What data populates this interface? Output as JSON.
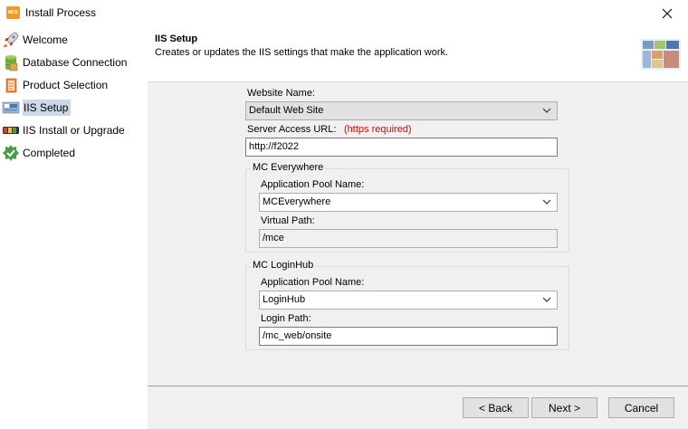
{
  "window": {
    "title": "Install Process",
    "app_icon_text": "MCE",
    "close_icon": "close-icon"
  },
  "sidebar": {
    "items": [
      {
        "label": "Welcome",
        "icon": "rocket-icon"
      },
      {
        "label": "Database Connection",
        "icon": "database-icon"
      },
      {
        "label": "Product Selection",
        "icon": "box-icon"
      },
      {
        "label": "IIS Setup",
        "icon": "iis-icon",
        "active": true
      },
      {
        "label": "IIS Install or Upgrade",
        "icon": "progress-bar-icon"
      },
      {
        "label": "Completed",
        "icon": "check-badge-icon"
      }
    ]
  },
  "header": {
    "title": "IIS Setup",
    "subtitle": "Creates or updates the IIS settings that make the application work.",
    "graphic_icon": "iis-setup-graphic-icon"
  },
  "form": {
    "website_name_label": "Website Name:",
    "website_name_value": "Default Web Site",
    "server_access_url_label": "Server Access URL:",
    "https_note": "(https required)",
    "server_access_url_value": "http://f2022",
    "mc_everywhere": {
      "title": "MC Everywhere",
      "app_pool_label": "Application Pool Name:",
      "app_pool_value": "MCEverywhere",
      "virtual_path_label": "Virtual Path:",
      "virtual_path_value": "/mce"
    },
    "mc_loginhub": {
      "title": "MC LoginHub",
      "app_pool_label": "Application Pool Name:",
      "app_pool_value": "LoginHub",
      "login_path_label": "Login Path:",
      "login_path_value": "/mc_web/onsite"
    }
  },
  "buttons": {
    "back": "< Back",
    "next": "Next >",
    "cancel": "Cancel"
  },
  "colors": {
    "accent_selected": "#ccd8e8",
    "required_text": "#e00000",
    "app_icon": "#f29a1f"
  }
}
